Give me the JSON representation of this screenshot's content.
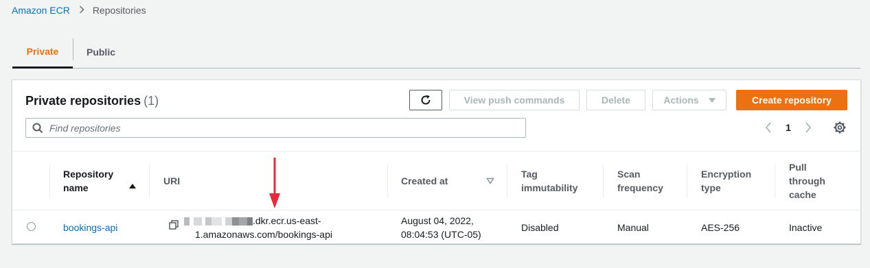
{
  "breadcrumb": {
    "root": "Amazon ECR",
    "current": "Repositories"
  },
  "tabs": [
    {
      "label": "Private",
      "active": true
    },
    {
      "label": "Public",
      "active": false
    }
  ],
  "panel": {
    "title": "Private repositories",
    "count": "(1)",
    "buttons": {
      "refresh_icon": "refresh-icon",
      "view_push_commands": "View push commands",
      "delete": "Delete",
      "actions": "Actions",
      "create_repository": "Create repository"
    },
    "search": {
      "placeholder": "Find repositories",
      "value": ""
    },
    "pagination": {
      "page": "1"
    }
  },
  "table": {
    "columns": [
      {
        "key": "name",
        "label": "Repository name",
        "sorted": "asc"
      },
      {
        "key": "uri",
        "label": "URI"
      },
      {
        "key": "created",
        "label": "Created at",
        "sortable": true
      },
      {
        "key": "tag",
        "label": "Tag immutability"
      },
      {
        "key": "scan",
        "label": "Scan frequency"
      },
      {
        "key": "enc",
        "label": "Encryption type"
      },
      {
        "key": "cache",
        "label": "Pull through cache"
      }
    ],
    "rows": [
      {
        "name": "bookings-api",
        "uri_line1": ".dkr.ecr.us-east-",
        "uri_line2": "1.amazonaws.com/bookings-api",
        "created_line1": "August 04, 2022,",
        "created_line2": "08:04:53 (UTC-05)",
        "tag": "Disabled",
        "scan": "Manual",
        "enc": "AES-256",
        "cache": "Inactive"
      }
    ]
  },
  "colors": {
    "accent": "#ec7211",
    "link": "#0073bb",
    "annotation_arrow": "#e8293a"
  }
}
